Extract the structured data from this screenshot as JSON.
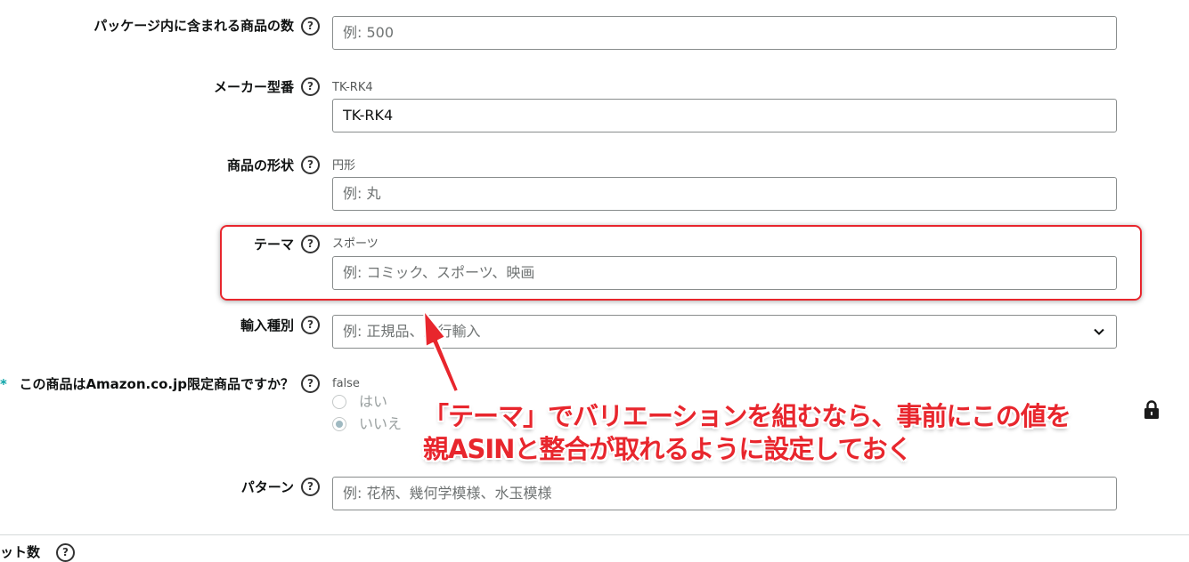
{
  "fields": {
    "package_qty": {
      "label": "パッケージ内に含まれる商品の数",
      "placeholder": "例: 500"
    },
    "model_number": {
      "label": "メーカー型番",
      "hint": "TK-RK4",
      "value": "TK-RK4"
    },
    "shape": {
      "label": "商品の形状",
      "hint": "円形",
      "placeholder": "例: 丸"
    },
    "theme": {
      "label": "テーマ",
      "hint": "スポーツ",
      "placeholder": "例: コミック、スポーツ、映画"
    },
    "import_type": {
      "label": "輸入種別",
      "placeholder": "例: 正規品、並行輸入"
    },
    "amazon_exclusive": {
      "required_mark": "*",
      "label": "この商品はAmazon.co.jp限定商品ですか？",
      "hint": "false",
      "options": [
        "はい",
        "いいえ"
      ],
      "selected": "いいえ"
    },
    "pattern": {
      "label": "パターン",
      "placeholder": "例: 花柄、幾何学模様、水玉模様"
    },
    "set_count": {
      "label": "ット数"
    }
  },
  "help_symbol": "?",
  "annotation": {
    "line1": "「テーマ」でバリエーションを組むなら、事前にこの値を",
    "line2": "親ASINと整合が取れるように設定しておく"
  },
  "colors": {
    "highlight": "#e8262d",
    "annotation_text": "#e8262d"
  },
  "icons": {
    "help": "question-circle-icon",
    "lock": "lock-icon",
    "dropdown": "chevron-down-icon",
    "arrow": "red-arrow"
  }
}
